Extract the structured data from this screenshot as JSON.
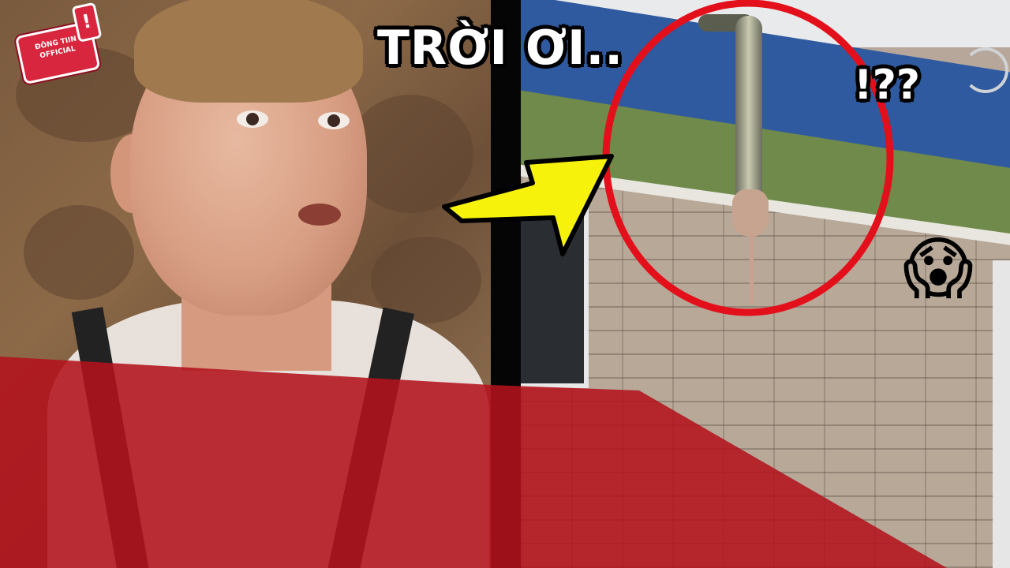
{
  "thumbnail": {
    "headline": "TRỜI ƠI..",
    "exclamation": "!??",
    "emoji": "😱",
    "logo": {
      "line1": "ĐÔNG TIIN",
      "line2": "OFFICIAL",
      "bang": "!"
    }
  },
  "colors": {
    "accent_red": "#b3121c",
    "circle_red": "#e3101b",
    "arrow_yellow": "#f7f20b",
    "text_white": "#ffffff"
  },
  "icons": {
    "arrow": "arrow-right-icon",
    "circle": "highlight-circle",
    "emoji": "face-screaming-in-fear-icon"
  }
}
